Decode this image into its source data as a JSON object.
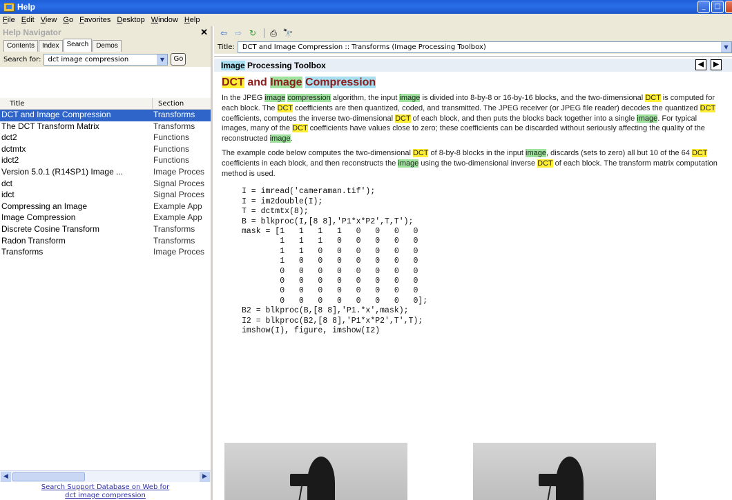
{
  "window": {
    "title": "Help",
    "buttons": [
      "_",
      "□",
      "✕"
    ]
  },
  "menu": [
    "File",
    "Edit",
    "View",
    "Go",
    "Favorites",
    "Desktop",
    "Window",
    "Help"
  ],
  "navigator": {
    "header": "Help Navigator",
    "close": "✕",
    "tabs": [
      "Contents",
      "Index",
      "Search",
      "Demos"
    ],
    "active_tab": "Search",
    "search_label": "Search for:",
    "search_value": "dct image compression",
    "go_label": "Go",
    "columns": [
      "Title",
      "Section"
    ],
    "results": [
      {
        "title": "DCT and Image Compression",
        "section": "Transforms",
        "selected": true
      },
      {
        "title": "The DCT Transform Matrix",
        "section": "Transforms"
      },
      {
        "title": "dct2",
        "section": "Functions"
      },
      {
        "title": "dctmtx",
        "section": "Functions"
      },
      {
        "title": "idct2",
        "section": "Functions"
      },
      {
        "title": "Version 5.0.1 (R14SP1) Image ...",
        "section": "Image Proces"
      },
      {
        "title": "dct",
        "section": "Signal Proces"
      },
      {
        "title": "idct",
        "section": "Signal Proces"
      },
      {
        "title": "Compressing an Image",
        "section": "Example App"
      },
      {
        "title": "Image Compression",
        "section": "Example App"
      },
      {
        "title": "Discrete Cosine Transform",
        "section": "Transforms"
      },
      {
        "title": "Radon Transform",
        "section": "Transforms"
      },
      {
        "title": "Transforms",
        "section": "Image Proces"
      }
    ],
    "support_link": "Search Support Database on Web for",
    "support_query": "dct image compression"
  },
  "toolbar": {
    "back": "⇦",
    "forward": "⇨",
    "refresh": "↻",
    "print": "⎙",
    "find": "🔭"
  },
  "titlefield": {
    "label": "Title:",
    "value": "DCT and Image Compression :: Transforms (Image Processing Toolbox)"
  },
  "doc": {
    "toolbox": "Image Processing Toolbox",
    "heading_parts": [
      "DCT",
      "and",
      "Image",
      "Compression"
    ],
    "para1": "In the JPEG image compression algorithm, the input image is divided into 8-by-8 or 16-by-16 blocks, and the two-dimensional DCT is computed for each block. The DCT coefficients are then quantized, coded, and transmitted. The JPEG receiver (or JPEG file reader) decodes the quantized DCT coefficients, computes the inverse two-dimensional DCT of each block, and then puts the blocks back together into a single image. For typical images, many of the DCT coefficients have values close to zero; these coefficients can be discarded without seriously affecting the quality of the reconstructed image.",
    "para2": "The example code below computes the two-dimensional DCT of 8-by-8 blocks in the input image, discards (sets to zero) all but 10 of the 64 DCT coefficients in each block, and then reconstructs the image using the two-dimensional inverse DCT of each block. The transform matrix computation method is used.",
    "code": [
      "I = imread('cameraman.tif');",
      "I = im2double(I);",
      "T = dctmtx(8);",
      "B = blkproc(I,[8 8],'P1*x*P2',T,T');",
      "mask = [1   1   1   1   0   0   0   0",
      "        1   1   1   0   0   0   0   0",
      "        1   1   0   0   0   0   0   0",
      "        1   0   0   0   0   0   0   0",
      "        0   0   0   0   0   0   0   0",
      "        0   0   0   0   0   0   0   0",
      "        0   0   0   0   0   0   0   0",
      "        0   0   0   0   0   0   0   0];",
      "B2 = blkproc(B,[8 8],'P1.*x',mask);",
      "I2 = blkproc(B2,[8 8],'P1*x*P2',T',T);",
      "imshow(I), figure, imshow(I2)"
    ]
  }
}
